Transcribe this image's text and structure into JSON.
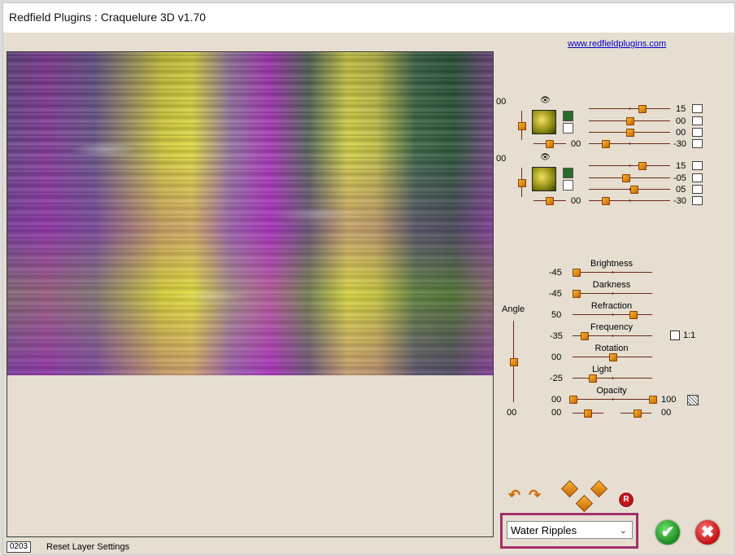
{
  "window": {
    "title": "Redfield Plugins : Craquelure 3D  v1.70"
  },
  "header": {
    "link": "www.redfieldplugins.com"
  },
  "status": {
    "code": "0203",
    "text": "Reset Layer Settings"
  },
  "layers": [
    {
      "left_value": "00",
      "sliders": [
        {
          "value": "15",
          "pos": 0.65
        },
        {
          "value": "00",
          "pos": 0.5
        },
        {
          "value": "00",
          "pos": 0.5
        },
        {
          "value": "-30",
          "pos": 0.2
        }
      ],
      "bottom_left_value": "00",
      "bottom_left_pos": 0.5,
      "vertical_pos": 0.5
    },
    {
      "left_value": "00",
      "sliders": [
        {
          "value": "15",
          "pos": 0.65
        },
        {
          "value": "-05",
          "pos": 0.45
        },
        {
          "value": "05",
          "pos": 0.55
        },
        {
          "value": "-30",
          "pos": 0.2
        }
      ],
      "bottom_left_value": "00",
      "bottom_left_pos": 0.5,
      "vertical_pos": 0.5
    }
  ],
  "params": [
    {
      "label": "Brightness",
      "value": "-45",
      "pos": 0.05
    },
    {
      "label": "Darkness",
      "value": "-45",
      "pos": 0.05
    },
    {
      "label": "Refraction",
      "value": "50",
      "pos": 0.75
    },
    {
      "label": "Frequency",
      "value": "-35",
      "pos": 0.15
    },
    {
      "label": "Rotation",
      "value": "00",
      "pos": 0.5
    },
    {
      "label": "Light",
      "value": "-25",
      "pos": 0.25
    }
  ],
  "opacity": {
    "label": "Opacity",
    "left": "00",
    "right": "100"
  },
  "bottom_row": {
    "a": "00",
    "b": "00"
  },
  "ratio": {
    "label": "1:1"
  },
  "angle": {
    "label": "Angle",
    "value": "00",
    "pos": 0.5
  },
  "effect": {
    "selected": "Water Ripples"
  },
  "icons": {
    "ok": "✔",
    "cancel": "✖",
    "reset": "R"
  }
}
